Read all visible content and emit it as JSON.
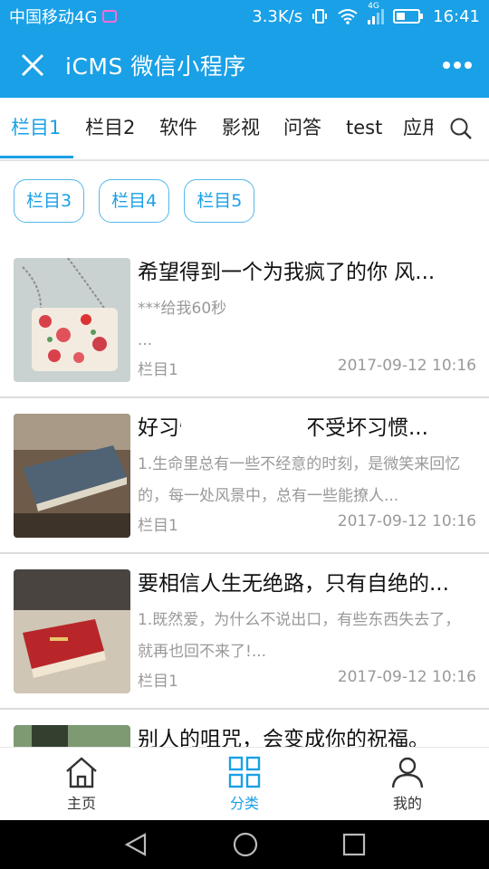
{
  "status_bar": {
    "carrier": "中国移动4G",
    "net_speed": "3.3K/s",
    "signal_label": "4G",
    "time": "16:41"
  },
  "nav": {
    "title": "iCMS 微信小程序",
    "close_icon": "close-icon",
    "more_icon": "more-dots-icon"
  },
  "tabs": [
    "栏目1",
    "栏目2",
    "软件",
    "影视",
    "问答",
    "test",
    "应用"
  ],
  "active_tab": 0,
  "chips": [
    "栏目3",
    "栏目4",
    "栏目5"
  ],
  "articles": [
    {
      "title": "希望得到一个为我疯了的你 风...",
      "desc": "***给我60秒\n...",
      "category": "栏目1",
      "date": "2017-09-12 10:16"
    },
    {
      "title": "好习惯的养成在于不受坏习惯...",
      "desc": "1.生命里总有一些不经意的时刻，是微笑来回忆的，每一处风景中，总有一些能撩人...",
      "category": "栏目1",
      "date": "2017-09-12 10:16"
    },
    {
      "title": "要相信人生无绝路，只有自绝的...",
      "desc": "1.既然爱，为什么不说出口，有些东西失去了，就再也回不来了!...",
      "category": "栏目1",
      "date": "2017-09-12 10:16"
    },
    {
      "title": "别人的咀咒，会变成你的祝福。",
      "desc": "",
      "category": "",
      "date": ""
    }
  ],
  "tabbar": {
    "items": [
      {
        "label": "主页",
        "icon": "home-icon"
      },
      {
        "label": "分类",
        "icon": "grid-icon"
      },
      {
        "label": "我的",
        "icon": "user-icon"
      }
    ],
    "active": 1
  },
  "colors": {
    "primary": "#1aa0e6",
    "text_dark": "#111111",
    "text_muted": "#999999"
  }
}
